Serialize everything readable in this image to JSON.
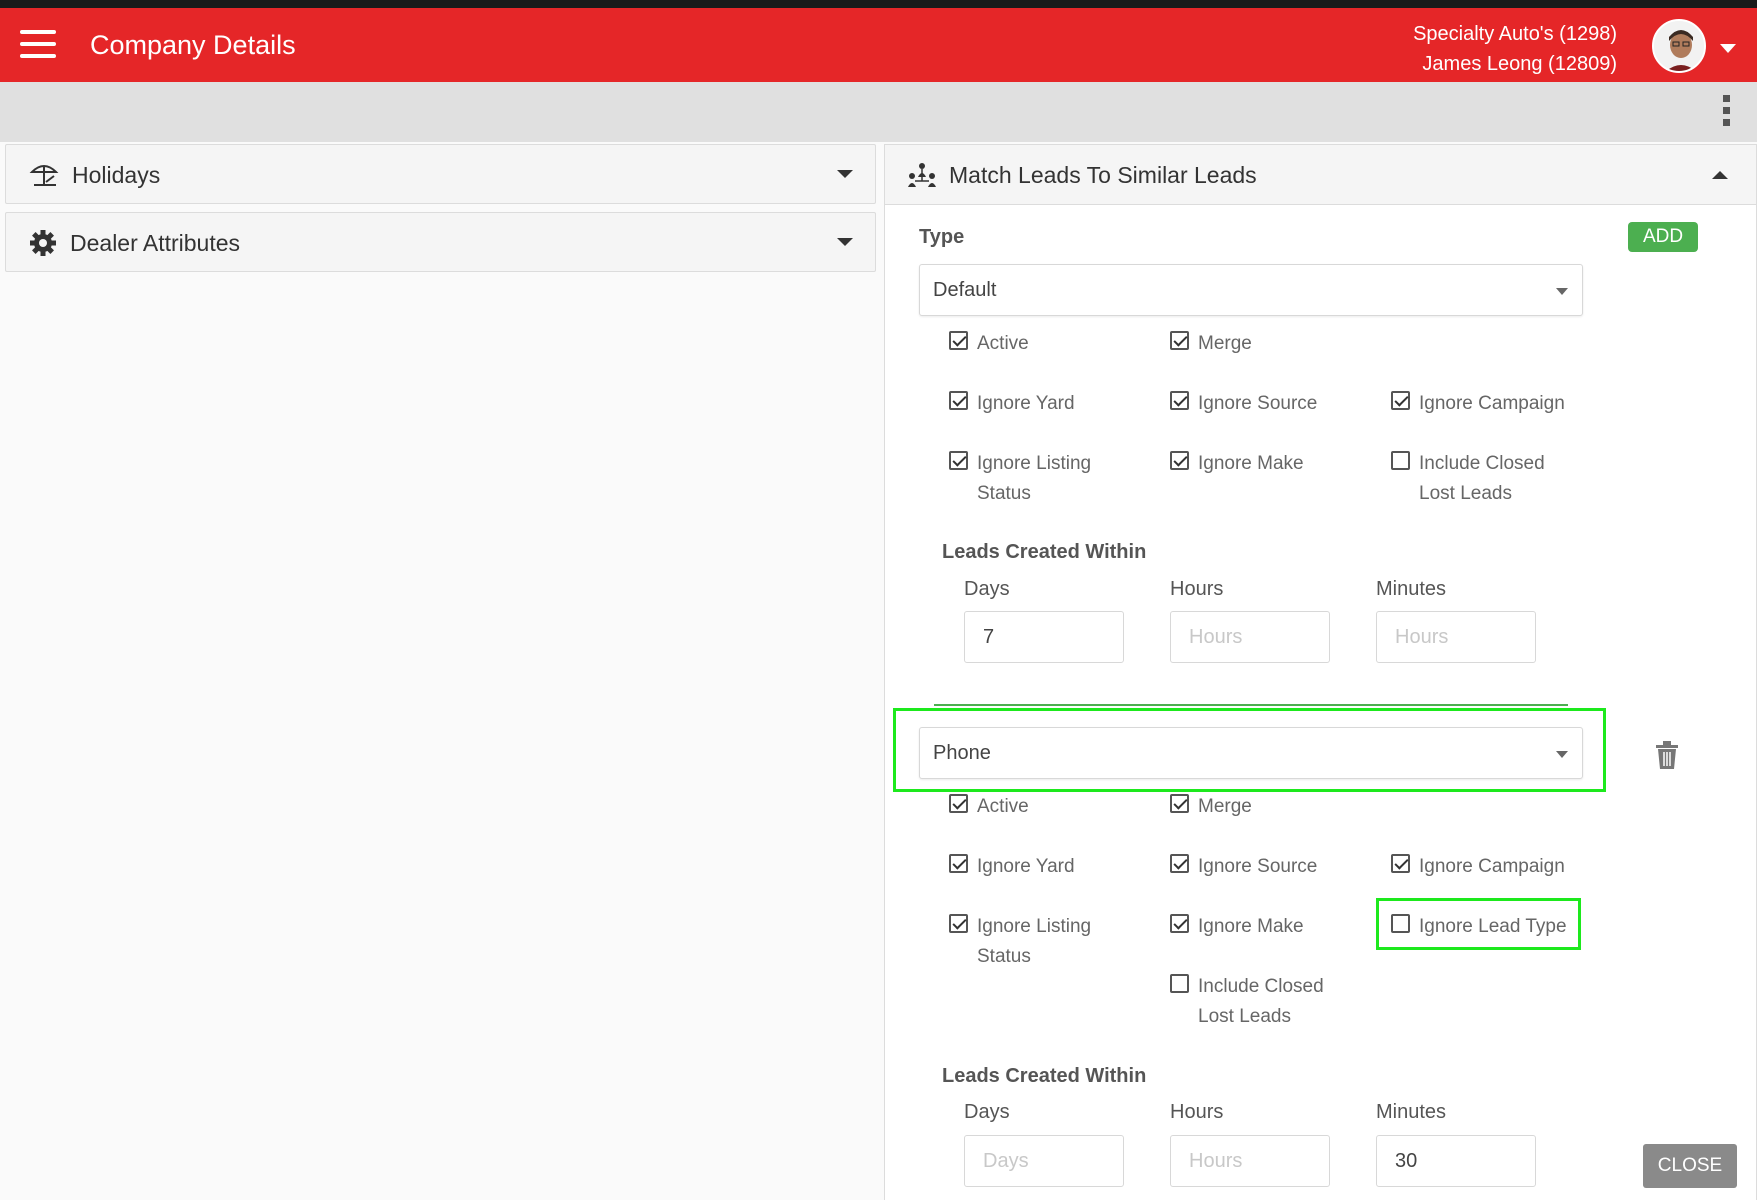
{
  "header": {
    "title": "Company Details",
    "dealer": "Specialty Auto's (1298)",
    "user": "James Leong (12809)"
  },
  "left_panels": [
    {
      "title": "Holidays",
      "icon": "beach-umbrella-icon"
    },
    {
      "title": "Dealer Attributes",
      "icon": "gear-icon"
    }
  ],
  "match_panel": {
    "title": "Match Leads To Similar Leads",
    "type_label": "Type",
    "add_label": "ADD",
    "rules": [
      {
        "type_value": "Default",
        "checkboxes": {
          "active": {
            "label": "Active",
            "checked": true
          },
          "merge": {
            "label": "Merge",
            "checked": true
          },
          "ignore_yard": {
            "label": "Ignore Yard",
            "checked": true
          },
          "ignore_source": {
            "label": "Ignore Source",
            "checked": true
          },
          "ignore_campaign": {
            "label": "Ignore Campaign",
            "checked": true
          },
          "ignore_listing_status": {
            "label_line1": "Ignore Listing",
            "label_line2": "Status",
            "checked": true
          },
          "ignore_make": {
            "label": "Ignore Make",
            "checked": true
          },
          "include_closed": {
            "label_line1": "Include Closed",
            "label_line2": "Lost Leads",
            "checked": false
          }
        },
        "leads_within_label": "Leads Created Within",
        "days": {
          "label": "Days",
          "value": "7",
          "placeholder": "Days"
        },
        "hours": {
          "label": "Hours",
          "value": "",
          "placeholder": "Hours"
        },
        "minutes": {
          "label": "Minutes",
          "value": "",
          "placeholder": "Hours"
        }
      },
      {
        "type_value": "Phone",
        "checkboxes": {
          "active": {
            "label": "Active",
            "checked": true
          },
          "merge": {
            "label": "Merge",
            "checked": true
          },
          "ignore_yard": {
            "label": "Ignore Yard",
            "checked": true
          },
          "ignore_source": {
            "label": "Ignore Source",
            "checked": true
          },
          "ignore_campaign": {
            "label": "Ignore Campaign",
            "checked": true
          },
          "ignore_listing_status": {
            "label_line1": "Ignore Listing",
            "label_line2": "Status",
            "checked": true
          },
          "ignore_make": {
            "label": "Ignore Make",
            "checked": true
          },
          "ignore_lead_type": {
            "label": "Ignore Lead Type",
            "checked": false
          },
          "include_closed": {
            "label_line1": "Include Closed",
            "label_line2": "Lost Leads",
            "checked": false
          }
        },
        "leads_within_label": "Leads Created Within",
        "days": {
          "label": "Days",
          "value": "",
          "placeholder": "Days"
        },
        "hours": {
          "label": "Hours",
          "value": "",
          "placeholder": "Hours"
        },
        "minutes": {
          "label": "Minutes",
          "value": "30",
          "placeholder": "Minutes"
        }
      }
    ]
  },
  "footer": {
    "close_label": "CLOSE"
  },
  "colors": {
    "brand_red": "#e52628",
    "success_green": "#4caf50",
    "highlight_green": "#1de91d"
  }
}
